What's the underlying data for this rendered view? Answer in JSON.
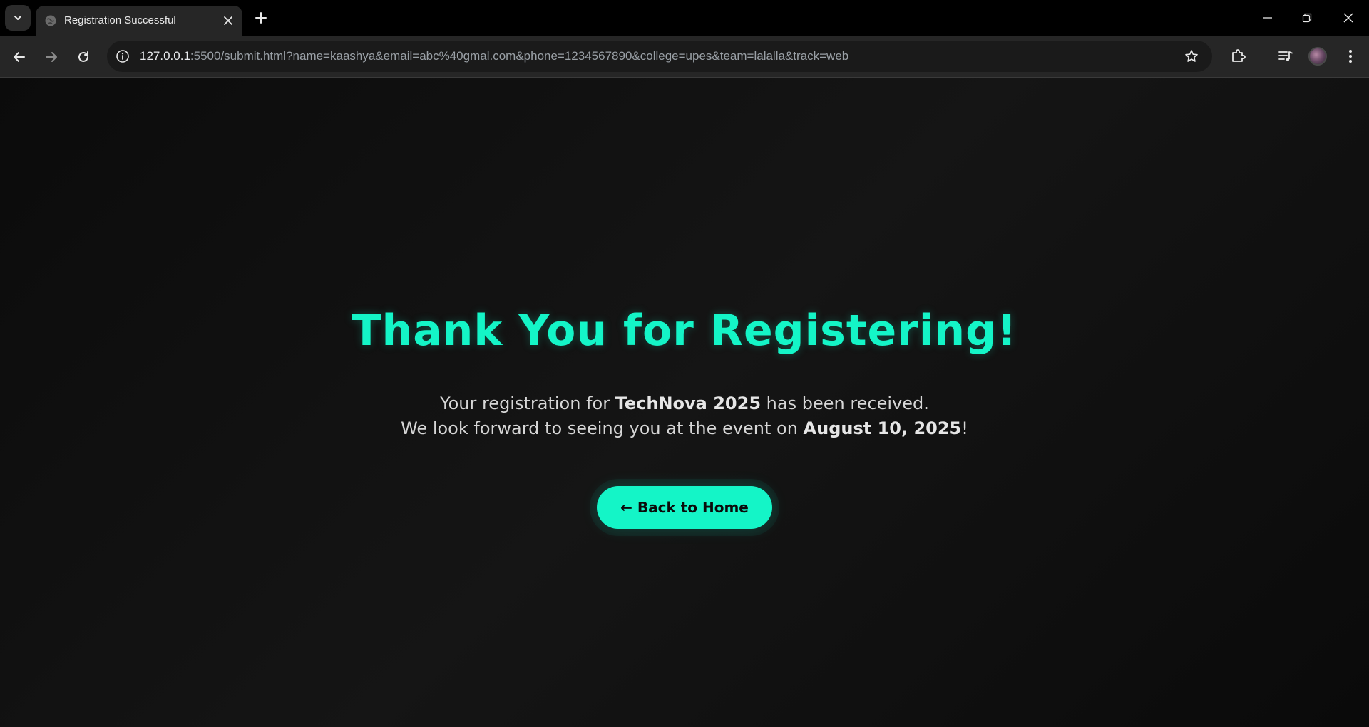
{
  "browser": {
    "tab_title": "Registration Successful",
    "url_host": "127.0.0.1",
    "url_rest": ":5500/submit.html?name=kaashya&email=abc%40gmal.com&phone=1234567890&college=upes&team=lalalla&track=web"
  },
  "page": {
    "heading": "Thank You for Registering!",
    "message_1_pre": "Your registration for ",
    "message_1_bold": "TechNova 2025",
    "message_1_post": " has been received.",
    "message_2_pre": "We look forward to seeing you at the event on ",
    "message_2_bold": "August 10, 2025",
    "message_2_post": "!",
    "back_button_label": "← Back to Home"
  },
  "colors": {
    "accent": "#14f5c7",
    "background": "#111111",
    "text": "#d6d6d6"
  },
  "icons": [
    "tab-list-icon",
    "globe-icon",
    "close-icon",
    "plus-icon",
    "minimize-icon",
    "restore-icon",
    "back-arrow-icon",
    "forward-arrow-icon",
    "reload-icon",
    "info-icon",
    "star-icon",
    "extensions-icon",
    "media-control-icon",
    "profile-avatar",
    "more-menu-icon"
  ]
}
